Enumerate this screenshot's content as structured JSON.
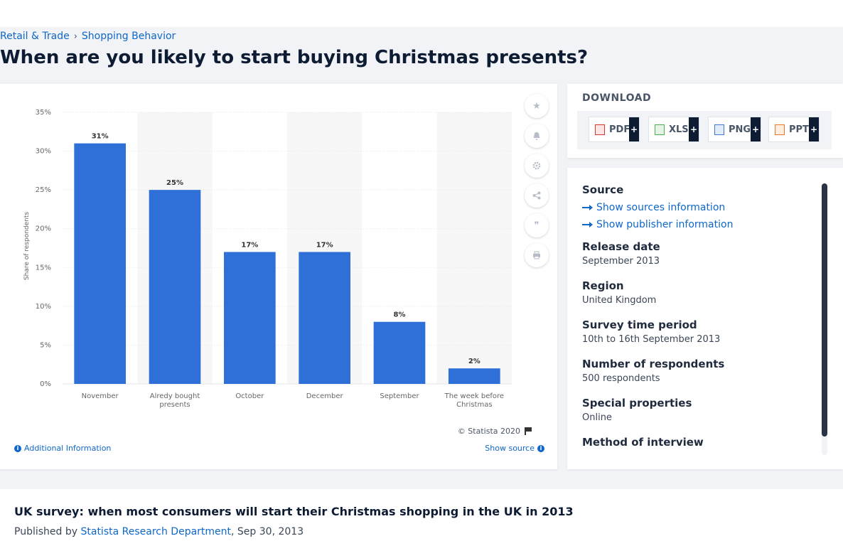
{
  "breadcrumb": {
    "items": [
      "Retail & Trade",
      "Shopping Behavior"
    ],
    "separator": "›"
  },
  "page": {
    "title": "When are you likely to start buying Christmas presents?"
  },
  "chart_data": {
    "type": "bar",
    "categories": [
      "November",
      "Alredy bought presents",
      "October",
      "December",
      "September",
      "The week before Christmas"
    ],
    "category_lines": [
      [
        "November"
      ],
      [
        "Alredy bought",
        "presents"
      ],
      [
        "October"
      ],
      [
        "December"
      ],
      [
        "September"
      ],
      [
        "The week before",
        "Christmas"
      ]
    ],
    "values": [
      31,
      25,
      17,
      17,
      8,
      2
    ],
    "value_labels": [
      "31%",
      "25%",
      "17%",
      "17%",
      "8%",
      "2%"
    ],
    "ylabel": "Share of respondents",
    "ylim": [
      0,
      35
    ],
    "yticks": [
      0,
      5,
      10,
      15,
      20,
      25,
      30,
      35
    ],
    "ytick_labels": [
      "0%",
      "5%",
      "10%",
      "15%",
      "20%",
      "25%",
      "30%",
      "35%"
    ],
    "bar_color": "#2e6fd8",
    "grid": true,
    "legend": "none"
  },
  "chart_footer": {
    "copyright": "© Statista 2020",
    "additional_info": "Additional Information",
    "show_source": "Show source"
  },
  "download": {
    "title": "DOWNLOAD",
    "buttons": [
      {
        "label": "PDF",
        "icon": "pdf-file-icon",
        "color": "#d9372b"
      },
      {
        "label": "XLS",
        "icon": "xls-file-icon",
        "color": "#4caf50"
      },
      {
        "label": "PNG",
        "icon": "png-file-icon",
        "color": "#3f7bd6"
      },
      {
        "label": "PPT",
        "icon": "ppt-file-icon",
        "color": "#e8762b"
      }
    ],
    "plus": "+"
  },
  "info": {
    "source_label": "Source",
    "show_sources": "Show sources information",
    "show_publisher": "Show publisher information",
    "fields": [
      {
        "label": "Release date",
        "value": "September 2013"
      },
      {
        "label": "Region",
        "value": "United Kingdom"
      },
      {
        "label": "Survey time period",
        "value": "10th to 16th September 2013"
      },
      {
        "label": "Number of respondents",
        "value": "500 respondents"
      },
      {
        "label": "Special properties",
        "value": "Online"
      },
      {
        "label": "Method of interview",
        "value": ""
      }
    ]
  },
  "publication": {
    "title": "UK survey: when most consumers will start their Christmas shopping in the UK in 2013",
    "published_by_prefix": "Published by",
    "publisher": "Statista Research Department",
    "date": ", Sep 30, 2013"
  }
}
